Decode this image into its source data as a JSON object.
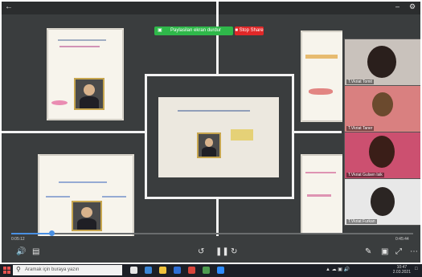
{
  "share_bar": {
    "message": "Paylasilan ekran durdur",
    "stop_label": "Stop Share"
  },
  "participants": [
    {
      "name": "T.Vkriat Tomit",
      "bg": "#c9c2bc",
      "head": "#2a1f1c"
    },
    {
      "name": "T.Vkriat Taner",
      "bg": "#d98080",
      "head": "#6b4a2e"
    },
    {
      "name": "T.Vkriat Gulsen Isik",
      "bg": "#cc5070",
      "head": "#3a1e18"
    },
    {
      "name": "T.Vkriat Furkan",
      "bg": "#e8e8e8",
      "head": "#2b2523"
    }
  ],
  "player": {
    "elapsed": "0:05:12",
    "duration": "0:45:44",
    "progress_fraction": 0.1
  },
  "taskbar": {
    "search_placeholder": "Aramak için buraya yazın",
    "time": "10:47",
    "date": "2.03.2021"
  },
  "colors": {
    "share_green": "#2fb84a",
    "stop_red": "#e02828",
    "progress": "#4a90e2"
  }
}
